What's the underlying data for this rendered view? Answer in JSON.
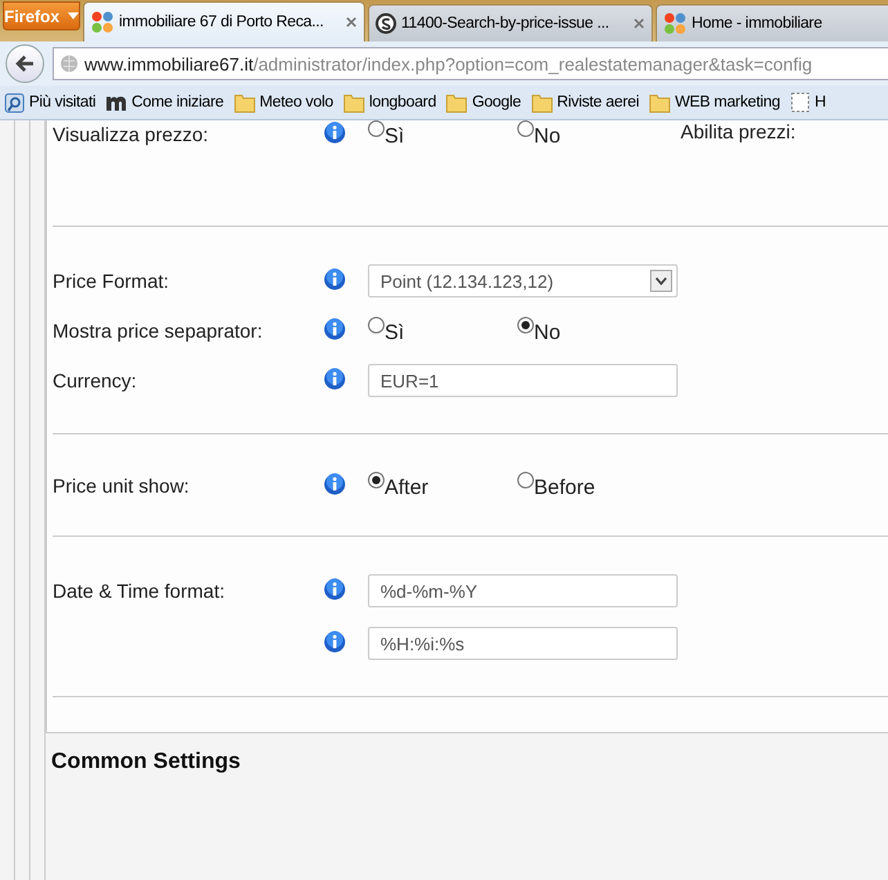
{
  "browser": {
    "menu_button": "Firefox",
    "tabs": [
      {
        "title": "immobiliare 67 di Porto Reca...",
        "selected": true,
        "kind": "joomla",
        "closable": true
      },
      {
        "title": "11400-Search-by-price-issue ...",
        "selected": false,
        "kind": "s",
        "closable": true
      },
      {
        "title": "Home - immobiliare",
        "selected": false,
        "kind": "joomla",
        "closable": false
      }
    ],
    "url": {
      "domain": "www.immobiliare67.it",
      "path": "/administrator/index.php?option=com_realestatemanager&task=config"
    },
    "bookmarks": [
      {
        "label": "Più visitati",
        "kind": "special"
      },
      {
        "label": "Come iniziare",
        "kind": "m"
      },
      {
        "label": "Meteo volo",
        "kind": "folder"
      },
      {
        "label": "longboard",
        "kind": "folder"
      },
      {
        "label": "Google",
        "kind": "folder"
      },
      {
        "label": "Riviste aerei",
        "kind": "folder"
      },
      {
        "label": "WEB marketing",
        "kind": "folder"
      },
      {
        "label": "H",
        "kind": "page"
      }
    ]
  },
  "settings": {
    "sections": [
      {
        "rows": [
          {
            "label": "Visualizza prezzo:",
            "kind": "radio",
            "options": [
              {
                "label": "Sì",
                "selected": false
              },
              {
                "label": "No",
                "selected": false
              }
            ],
            "side_label": "Abilita prezzi:"
          }
        ]
      },
      {
        "rows": [
          {
            "label": "Price Format:",
            "kind": "select",
            "value": "Point (12.134.123,12)"
          },
          {
            "label": "Mostra price sepaprator:",
            "kind": "radio",
            "options": [
              {
                "label": "Sì",
                "selected": false
              },
              {
                "label": "No",
                "selected": true
              }
            ]
          },
          {
            "label": "Currency:",
            "kind": "text",
            "values": [
              "EUR=1"
            ]
          }
        ]
      },
      {
        "rows": [
          {
            "label": "Price unit show:",
            "kind": "radio",
            "options": [
              {
                "label": "After",
                "selected": true
              },
              {
                "label": "Before",
                "selected": false
              }
            ]
          }
        ]
      },
      {
        "rows": [
          {
            "label": "Date & Time format:",
            "kind": "text",
            "values": [
              "%d-%m-%Y",
              "%H:%i:%s"
            ]
          }
        ]
      }
    ],
    "next_section_title": "Common Settings"
  }
}
